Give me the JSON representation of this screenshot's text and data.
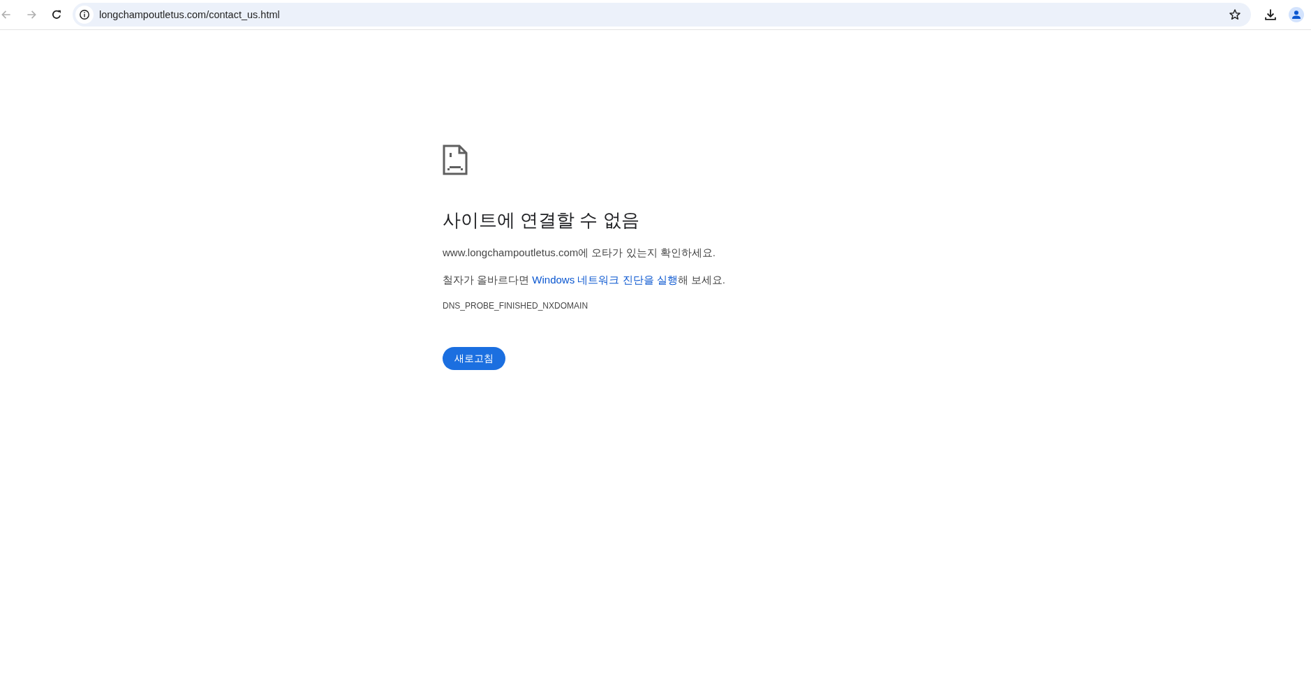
{
  "toolbar": {
    "back": {
      "disabled": true
    },
    "forward": {
      "disabled": true
    },
    "address": "longchampoutletus.com/contact_us.html"
  },
  "error_page": {
    "heading": "사이트에 연결할 수 없음",
    "message": "www.longchampoutletus.com에 오타가 있는지 확인하세요.",
    "suggestion": {
      "before": "철자가 올바르다면 ",
      "link": "Windows 네트워크 진단을 실행",
      "after": "해 보세요."
    },
    "error_code": "DNS_PROBE_FINISHED_NXDOMAIN",
    "button": "새로고침"
  }
}
